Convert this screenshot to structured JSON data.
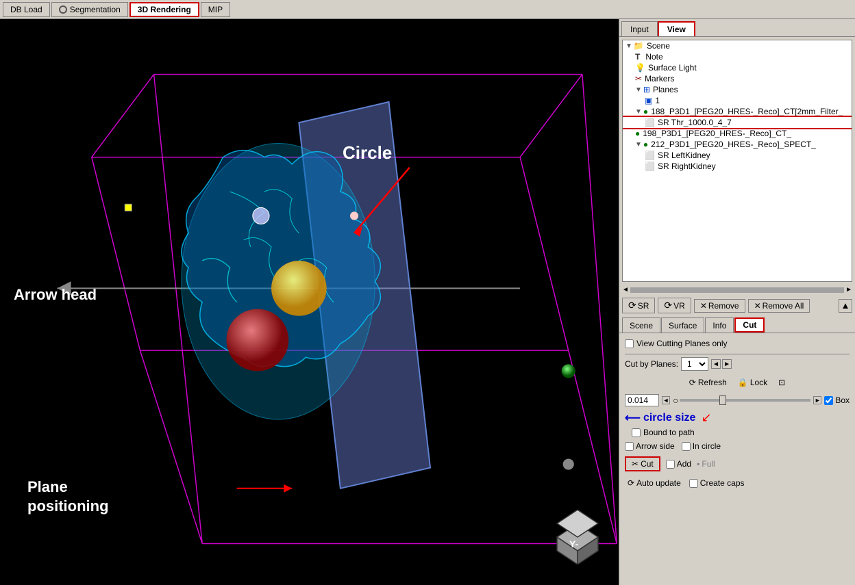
{
  "tabs": {
    "db_load": "DB Load",
    "segmentation": "Segmentation",
    "rendering_3d": "3D Rendering",
    "mip": "MIP"
  },
  "panel": {
    "input_tab": "Input",
    "view_tab": "View"
  },
  "scene_tree": {
    "items": [
      {
        "label": "Scene",
        "indent": 0,
        "icon": "folder",
        "arrow": "▼",
        "selected": false
      },
      {
        "label": "Note",
        "indent": 1,
        "icon": "T",
        "arrow": "",
        "selected": false
      },
      {
        "label": "Surface Light",
        "indent": 1,
        "icon": "bulb",
        "arrow": "",
        "selected": false
      },
      {
        "label": "Markers",
        "indent": 1,
        "icon": "scissors",
        "arrow": "",
        "selected": false
      },
      {
        "label": "Planes",
        "indent": 1,
        "icon": "planes",
        "arrow": "▼",
        "selected": false
      },
      {
        "label": "1",
        "indent": 2,
        "icon": "plane",
        "arrow": "",
        "selected": false
      },
      {
        "label": "188_P3D1_[PEG20_HRES-_Reco]_CT[2mm_Filter_",
        "indent": 1,
        "icon": "circle",
        "arrow": "▼",
        "selected": false
      },
      {
        "label": "SR Thr_1000.0_4_7",
        "indent": 2,
        "icon": "sphere",
        "arrow": "",
        "selected": true
      },
      {
        "label": "198_P3D1_[PEG20_HRES-_Reco]_CT_",
        "indent": 1,
        "icon": "circle",
        "arrow": "",
        "selected": false
      },
      {
        "label": "212_P3D1_[PEG20_HRES-_Reco]_SPECT_",
        "indent": 1,
        "icon": "circle",
        "arrow": "▼",
        "selected": false
      },
      {
        "label": "SR LeftKidney",
        "indent": 2,
        "icon": "sphere",
        "arrow": "",
        "selected": false
      },
      {
        "label": "SR RightKidney",
        "indent": 2,
        "icon": "sphere",
        "arrow": "",
        "selected": false
      }
    ]
  },
  "action_buttons": {
    "sr": "SR",
    "vr": "VR",
    "remove": "Remove",
    "remove_all": "Remove All"
  },
  "sub_tabs": {
    "scene": "Scene",
    "surface": "Surface",
    "info": "Info",
    "cut": "Cut"
  },
  "cut_panel": {
    "view_cutting_planes_only": "View Cutting Planes only",
    "cut_by_planes_label": "Cut by Planes:",
    "cut_by_planes_value": "1",
    "refresh": "Refresh",
    "lock": "Lock",
    "value": "0.014",
    "box_label": "Box",
    "bound_to_path": "Bound to path",
    "arrow_side": "Arrow side",
    "in_circle": "In circle",
    "cut": "Cut",
    "add": "Add",
    "full": "Full",
    "auto_update": "Auto update",
    "create_caps": "Create caps",
    "circle_size_annotation": "circle size"
  },
  "viewport_labels": {
    "circle": "Circle",
    "arrow_head": "Arrow head",
    "plane_positioning": "Plane\npositioning"
  },
  "cube": {
    "face": "Y-"
  }
}
